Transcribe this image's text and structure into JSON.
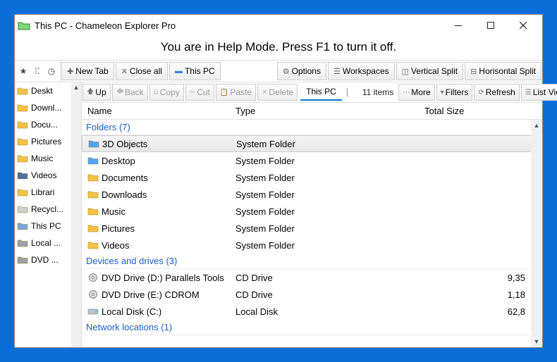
{
  "title": "This PC - Chameleon Explorer Pro",
  "help_banner": "You are in Help Mode. Press F1 to turn it off.",
  "top_toolbar": {
    "new_tab": "New Tab",
    "close_all": "Close all",
    "this_pc": "This PC",
    "options": "Options",
    "workspaces": "Workspaces",
    "vsplit": "Vertical Split",
    "hsplit": "Horisontal Split"
  },
  "action_bar": {
    "up": "Up",
    "back": "Back",
    "copy": "Copy",
    "cut": "Cut",
    "paste": "Paste",
    "delete": "Delete",
    "tab_label": "This PC",
    "item_count": "11 items",
    "more": "More",
    "filters": "Filters",
    "refresh": "Refresh",
    "list_view": "List View"
  },
  "sidebar": [
    {
      "label": "Deskt",
      "color": "#f6c244"
    },
    {
      "label": "Downl...",
      "color": "#f6c244"
    },
    {
      "label": "Docu...",
      "color": "#f6c244"
    },
    {
      "label": "Pictures",
      "color": "#f6c244"
    },
    {
      "label": "Music",
      "color": "#f6c244"
    },
    {
      "label": "Videos",
      "color": "#4a6fa0"
    },
    {
      "label": "Librari",
      "color": "#f6c244"
    },
    {
      "label": "Recycl...",
      "color": "#cfcfcf"
    },
    {
      "label": "This PC",
      "color": "#7aa6d8"
    },
    {
      "label": "Local ...",
      "color": "#9aa0a7"
    },
    {
      "label": "DVD ...",
      "color": "#9aa0a7"
    }
  ],
  "columns": {
    "name": "Name",
    "type": "Type",
    "size": "Total Size"
  },
  "groups": [
    {
      "title": "Folders (7)",
      "rows": [
        {
          "name": "3D Objects",
          "type": "System Folder",
          "size": "",
          "icon": "folder-3d",
          "selected": true
        },
        {
          "name": "Desktop",
          "type": "System Folder",
          "size": "",
          "icon": "folder-blue"
        },
        {
          "name": "Documents",
          "type": "System Folder",
          "size": "",
          "icon": "folder-doc"
        },
        {
          "name": "Downloads",
          "type": "System Folder",
          "size": "",
          "icon": "folder-down"
        },
        {
          "name": "Music",
          "type": "System Folder",
          "size": "",
          "icon": "folder-music"
        },
        {
          "name": "Pictures",
          "type": "System Folder",
          "size": "",
          "icon": "folder-pic"
        },
        {
          "name": "Videos",
          "type": "System Folder",
          "size": "",
          "icon": "folder-vid"
        }
      ]
    },
    {
      "title": "Devices and drives (3)",
      "rows": [
        {
          "name": "DVD Drive (D:) Parallels Tools",
          "type": "CD Drive",
          "size": "9,35",
          "icon": "dvd"
        },
        {
          "name": "DVD Drive (E:) CDROM",
          "type": "CD Drive",
          "size": "1,18",
          "icon": "dvd2"
        },
        {
          "name": "Local Disk (C:)",
          "type": "Local Disk",
          "size": "62,8",
          "icon": "disk"
        }
      ]
    },
    {
      "title": "Network locations (1)",
      "rows": []
    }
  ]
}
